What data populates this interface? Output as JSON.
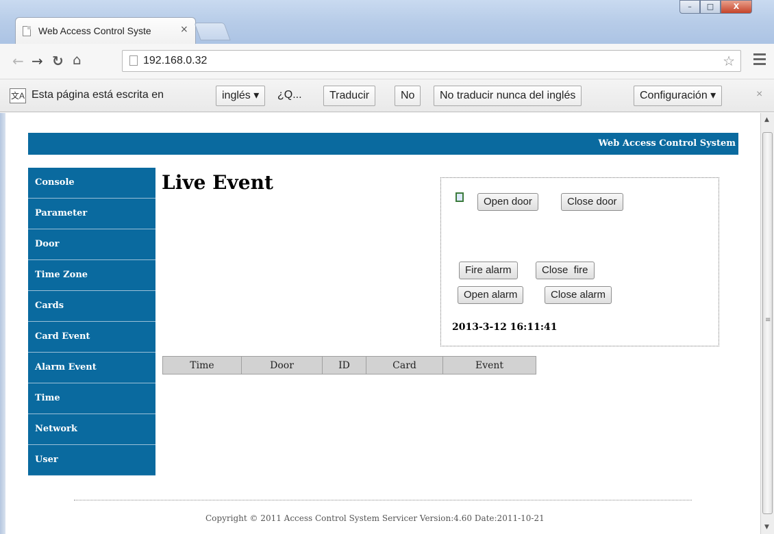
{
  "browser": {
    "tab_title": "Web Access Control Syste",
    "tab_close": "×",
    "url": "192.168.0.32",
    "star": "☆",
    "win_minimize": "–",
    "win_maximize": "□",
    "win_close": "X"
  },
  "translate_bar": {
    "icon": "文A",
    "prefix": "Esta página está escrita en",
    "language": "inglés ▾",
    "question": "¿Q...",
    "translate": "Traducir",
    "no": "No",
    "never": "No traducir nunca del inglés",
    "settings": "Configuración ▾",
    "close": "×"
  },
  "header": {
    "title": "Web Access Control System"
  },
  "sidebar": {
    "items": [
      {
        "label": "Console"
      },
      {
        "label": "Parameter"
      },
      {
        "label": "Door"
      },
      {
        "label": "Time Zone"
      },
      {
        "label": "Cards"
      },
      {
        "label": "Card Event"
      },
      {
        "label": "Alarm Event"
      },
      {
        "label": "Time"
      },
      {
        "label": "Network"
      },
      {
        "label": "User"
      }
    ]
  },
  "main": {
    "heading": "Live Event",
    "controls": {
      "open_door": "Open door",
      "close_door": "Close door",
      "fire_alarm": "Fire alarm",
      "close_fire": "Close  fire",
      "open_alarm": "Open alarm",
      "close_alarm": "Close alarm",
      "datetime": "2013-3-12 16:11:41"
    },
    "table": {
      "columns": [
        "Time",
        "Door",
        "ID",
        "Card",
        "Event"
      ]
    }
  },
  "footer": {
    "text": "Copyright © 2011 Access Control System Servicer Version:4.60 Date:2011-10-21"
  },
  "colors": {
    "nav_blue": "#0a6a9f"
  }
}
